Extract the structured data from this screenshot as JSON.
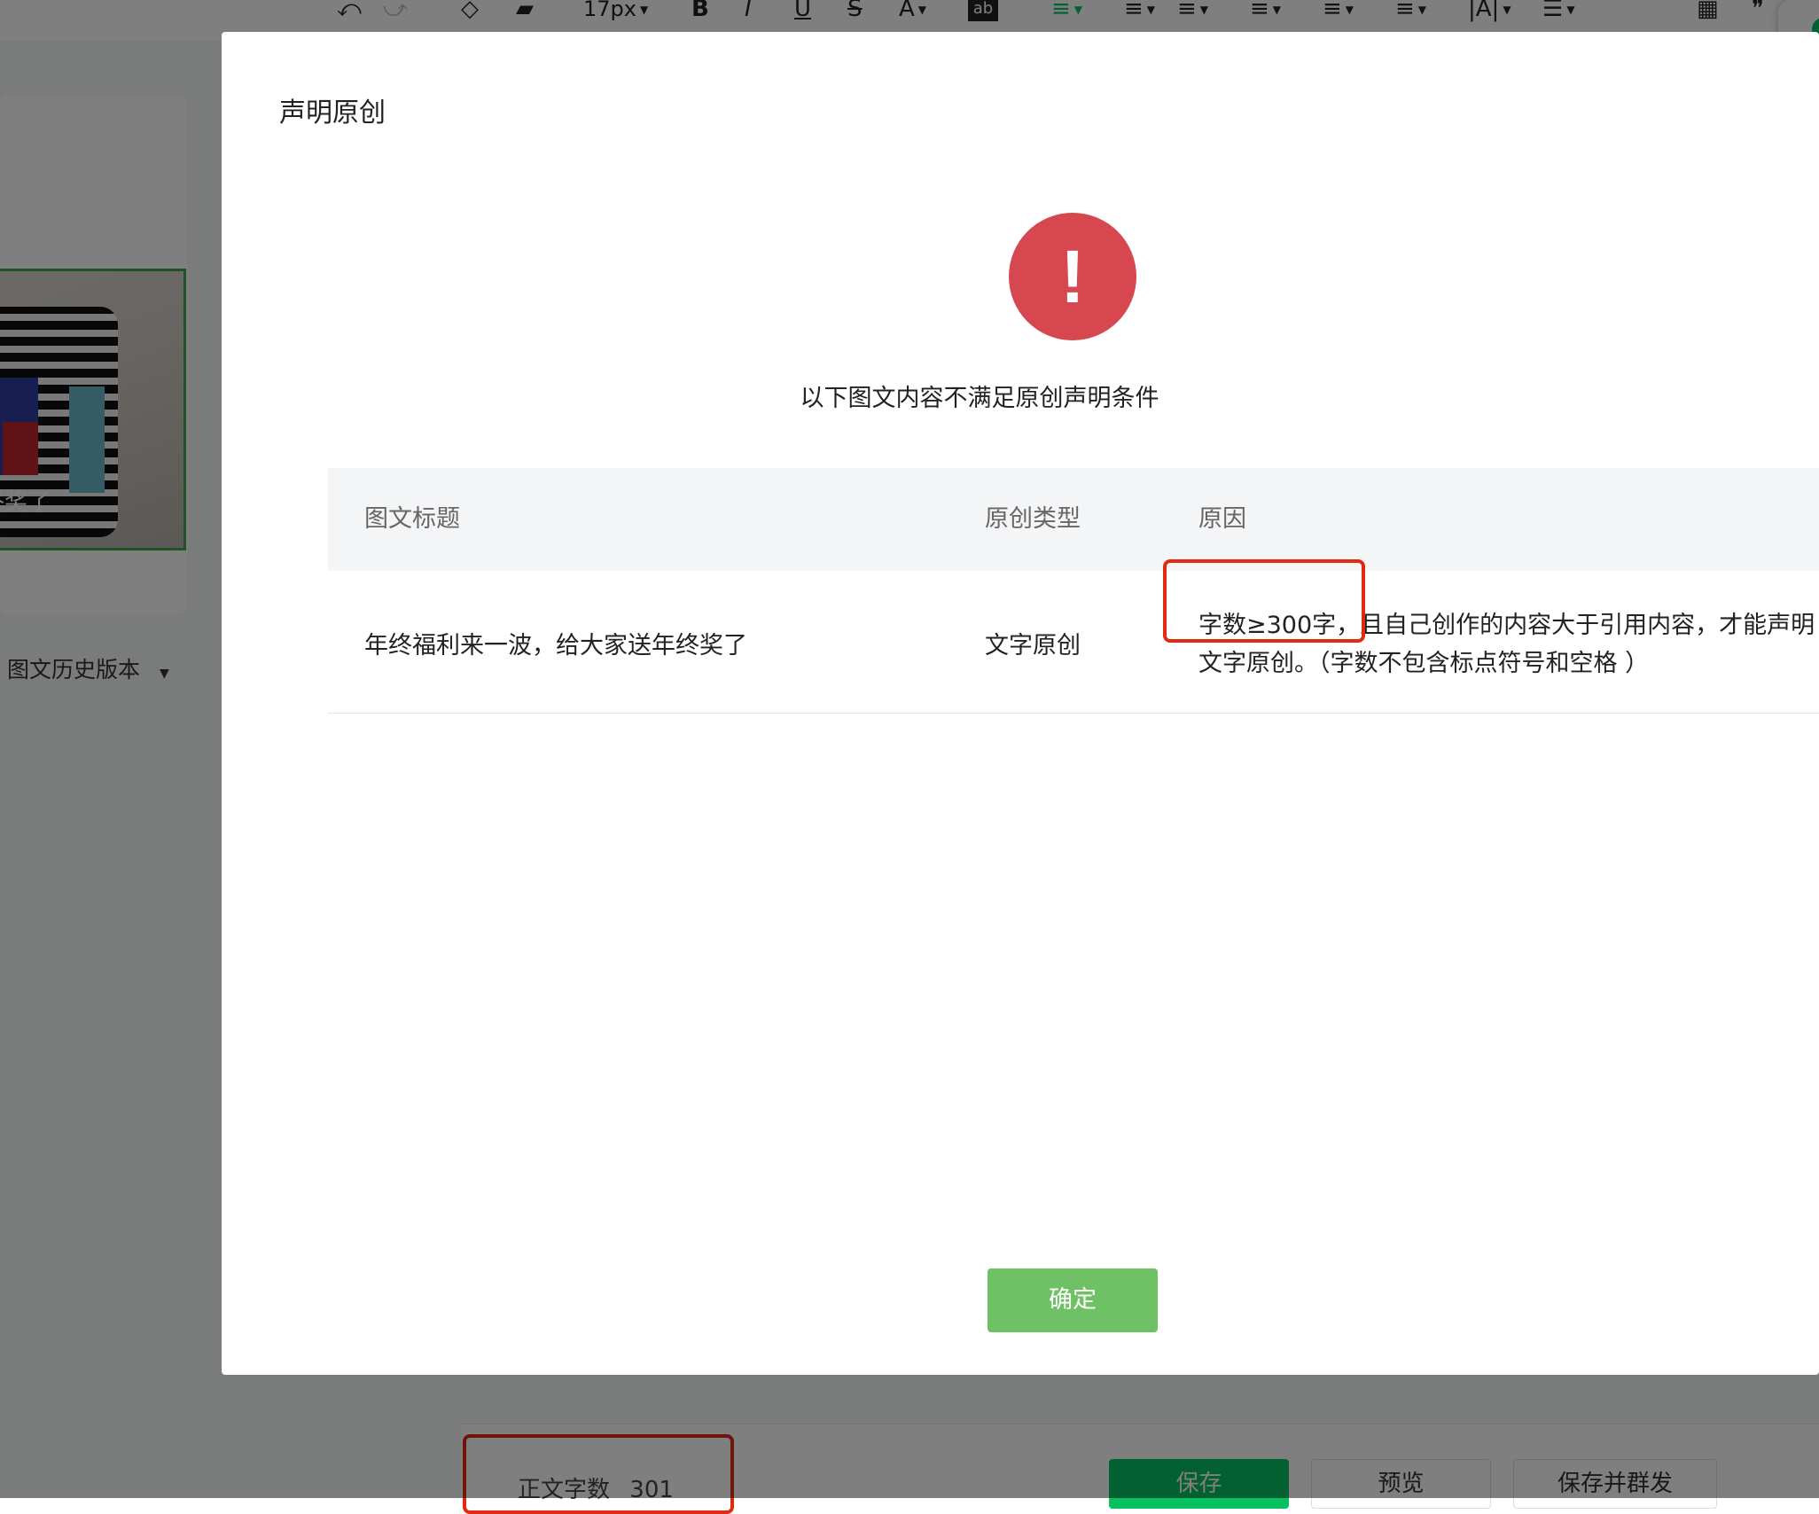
{
  "toolbar": {
    "font_size": "17px",
    "tools": [
      "undo-icon",
      "redo-icon",
      "format-brush-icon",
      "clear-format-icon",
      "bold-icon",
      "italic-icon",
      "underline-icon",
      "strikethrough-icon",
      "font-color-icon",
      "background-color-icon",
      "align-left-icon",
      "indent-icon",
      "align-center-icon",
      "align-justify-icon",
      "line-height-icon",
      "list-spacing-icon",
      "letter-spacing-icon",
      "bullet-list-icon",
      "table-icon",
      "quote-icon"
    ]
  },
  "sidebar": {
    "thumb_caption": "终奖了",
    "history_label": "图文历史版本"
  },
  "footer": {
    "word_count_label": "正文字数",
    "word_count_value": "301",
    "save_label": "保存",
    "preview_label": "预览",
    "save_send_label": "保存并群发"
  },
  "dialog": {
    "title": "声明原创",
    "icon": "exclamation-icon",
    "icon_glyph": "!",
    "message": "以下图文内容不满足原创声明条件",
    "columns": [
      "图文标题",
      "原创类型",
      "原因"
    ],
    "rows": [
      {
        "title": "年终福利来一波，给大家送年终奖了",
        "type": "文字原创",
        "reason": "字数≥300字，且自己创作的内容大于引用内容，才能声明文字原创。（字数不包含标点符号和空格 ）"
      }
    ],
    "confirm_label": "确定"
  },
  "colors": {
    "accent_green": "#07c160",
    "confirm_green": "#6ec265",
    "alert_red": "#d6474f",
    "highlight_red": "#e02b12"
  }
}
